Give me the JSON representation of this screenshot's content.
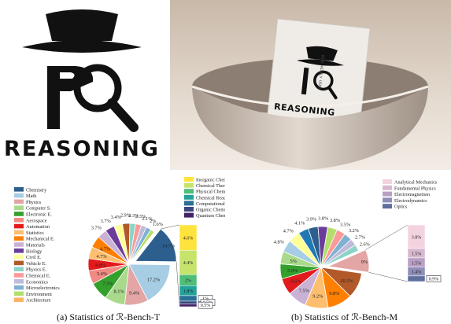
{
  "logo": {
    "word": "REASONING"
  },
  "photo": {
    "card_word": "REASONING",
    "card_side_text": "BUSE WIDELY USED"
  },
  "captions": {
    "left": "(a) Statistics of ℛ-Bench-T",
    "right": "(b) Statistics of ℛ-Bench-M"
  },
  "chart_data": [
    {
      "type": "pie",
      "title": "(a) Statistics of ℛ-Bench-T",
      "legend": [
        "Chemistry",
        "Math",
        "Physics",
        "Computer S.",
        "Electronic E.",
        "Aerospace",
        "Automation",
        "Statistics",
        "Mechanical E.",
        "Materials",
        "Biology",
        "Civil E.",
        "Vehicle E.",
        "Physics E.",
        "Chemical E.",
        "Economics",
        "Microelectronics",
        "Environment",
        "Architecture"
      ],
      "colors": [
        "#2c5f8e",
        "#a6cde3",
        "#e3a5a5",
        "#a9d98b",
        "#33a02c",
        "#f08a82",
        "#e31a1c",
        "#fdbf6f",
        "#ff7f00",
        "#cab2d6",
        "#6a3d9a",
        "#ffff99",
        "#b15928",
        "#8dd3c7",
        "#fb9a99",
        "#bebada",
        "#80b1d3",
        "#b3de69",
        "#fdb462"
      ],
      "label_texts": [
        "14.7%",
        "17.2%",
        "9.4%",
        "8.1%",
        "7.3%",
        "5.4%",
        "4.8%",
        "4.7%",
        "4.7%",
        "3.7%",
        "3.7%",
        "3.4%",
        "2.9%",
        "2.3%",
        "2.3%",
        "2.1%",
        "2%",
        "1.6%"
      ],
      "values": [
        14.7,
        17.2,
        9.4,
        8.1,
        7.3,
        5.4,
        4.8,
        4.7,
        4.7,
        3.7,
        3.7,
        3.4,
        2.9,
        2.3,
        2.3,
        2.1,
        2,
        1.6,
        0
      ],
      "breakdown": {
        "legend": [
          "Inorganic Chemistry",
          "Chemical Thermodynamics",
          "Physical Chemistry",
          "Chemical Reaction Kinetics",
          "Computational Chemistry",
          "Organic Chemistry",
          "Quantum Chemistry"
        ],
        "values": [
          4.6,
          4.4,
          2,
          1.8,
          1,
          0.5,
          0.5
        ],
        "label_texts": [
          "4.6%",
          "4.4%",
          "2%",
          "1.8%",
          "1%",
          "0.5%",
          "0.5%"
        ],
        "colors": [
          "#ffe33d",
          "#c6e36c",
          "#4fbf78",
          "#22a39b",
          "#2a6f96",
          "#38477f",
          "#432166"
        ]
      }
    },
    {
      "type": "pie",
      "title": "(b) Statistics of ℛ-Bench-M",
      "label_texts": [
        "9%",
        "10.2%",
        "9.8%",
        "9.2%",
        "7.5%",
        "6.6%",
        "5.9%",
        "5%",
        "4.8%",
        "4.7%",
        "4.1%",
        "3.9%",
        "3.8%",
        "3.8%",
        "3.5%",
        "3.2%",
        "2.7%",
        "2.6%"
      ],
      "values": [
        9,
        10.2,
        9.8,
        9.2,
        7.5,
        6.6,
        5.9,
        5,
        4.8,
        4.7,
        4.1,
        3.9,
        3.8,
        3.8,
        3.5,
        3.2,
        2.7,
        2.6
      ],
      "colors": [
        "#e3a5a5",
        "#b15928",
        "#ff7f00",
        "#fdbf6f",
        "#cab2d6",
        "#e31a1c",
        "#33a02c",
        "#a9d98b",
        "#a6cde3",
        "#ffff99",
        "#1f78b4",
        "#2c5f8e",
        "#6a3d9a",
        "#b3de69",
        "#fb9a99",
        "#80b1d3",
        "#bebada",
        "#8dd3c7"
      ],
      "breakdown": {
        "legend": [
          "Analytical Mechanics",
          "Fundamental Physics",
          "Electromagnetism",
          "Electrodynamics",
          "Optics"
        ],
        "values": [
          3.8,
          1.5,
          1.5,
          1.4,
          0.9
        ],
        "label_texts": [
          "3.8%",
          "1.5%",
          "1.5%",
          "1.4%",
          "0.9%"
        ],
        "colors": [
          "#f4d3e1",
          "#d8b8cf",
          "#b8a0c4",
          "#8e8eb8",
          "#5f6f9e"
        ]
      }
    }
  ]
}
